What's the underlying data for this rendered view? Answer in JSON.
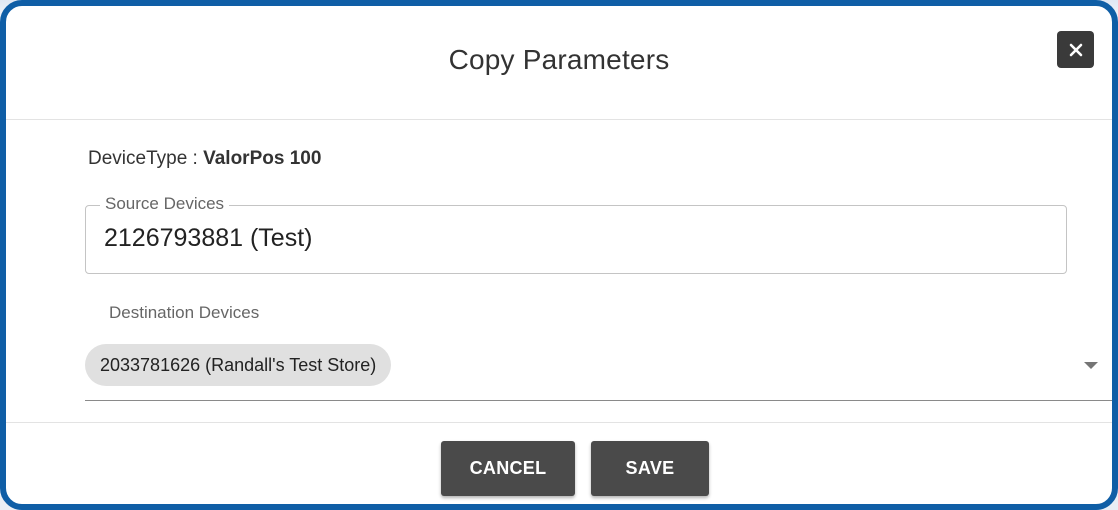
{
  "dialog": {
    "title": "Copy Parameters",
    "close_icon": "close-icon"
  },
  "device_type": {
    "label": "DeviceType : ",
    "value": "ValorPos 100"
  },
  "source_devices": {
    "label": "Source Devices",
    "value": "2126793881 (Test)"
  },
  "destination_devices": {
    "label": "Destination Devices",
    "selected": [
      "2033781626 (Randall's Test Store)"
    ],
    "dropdown_icon": "caret-down-icon"
  },
  "buttons": {
    "cancel_label": "CANCEL",
    "save_label": "SAVE"
  },
  "colors": {
    "frame_border": "#0f5ea6",
    "button_bg": "#4a4a4a",
    "chip_bg": "#e0e0e0"
  }
}
